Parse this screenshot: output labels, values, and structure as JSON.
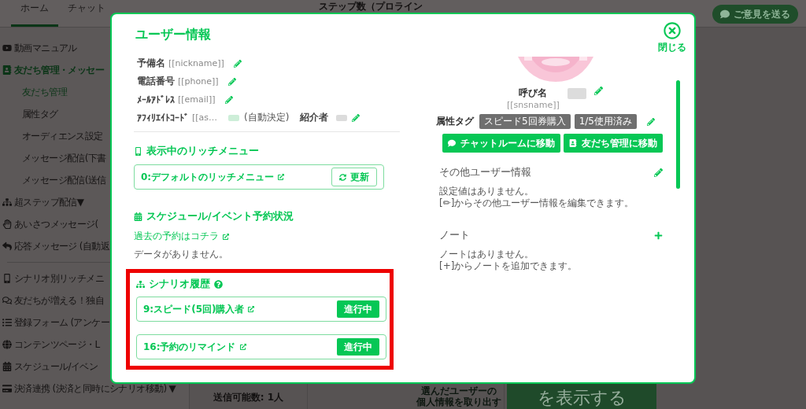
{
  "nav": {
    "tabs": [
      {
        "label": "ホーム",
        "selected": true
      },
      {
        "label": "チャット",
        "selected": false
      }
    ],
    "header_text": "ステップ数（プロライン",
    "feedback_button": "ご意見を送る"
  },
  "sidebar": {
    "groups": [
      {
        "items": [
          {
            "label": "動画マニュアル",
            "selected": false
          },
          {
            "label": "友だち管理・メッセー",
            "selected": true,
            "children": [
              {
                "label": "友だち管理",
                "selected": true
              },
              {
                "label": "属性タグ",
                "selected": false
              },
              {
                "label": "オーディエンス設定",
                "selected": false
              },
              {
                "label": "メッセージ配信(下書",
                "selected": false
              },
              {
                "label": "メッセージ配信(送信",
                "selected": false
              }
            ]
          },
          {
            "label": "超ステップ配信▼",
            "selected": false
          },
          {
            "label": "あいさつメッセージ(",
            "selected": false
          },
          {
            "label": "応答メッセージ",
            "note": "(自動返",
            "selected": false
          }
        ]
      },
      {
        "items": [
          {
            "label": "シナリオ別リッチメニ",
            "selected": false
          },
          {
            "label": "友だちが増える！独自",
            "selected": false
          },
          {
            "label": "登録フォーム",
            "note": "(アンケー",
            "selected": false
          },
          {
            "label": "コンテンツページ・L",
            "selected": false
          },
          {
            "label": "スケジュール/イベン",
            "selected": false
          },
          {
            "label": "決済連携",
            "note": "(決済と同時にシナリオ移動)",
            "suffix": "▼",
            "selected": false
          }
        ]
      }
    ]
  },
  "main": {
    "send_count": "送信可能数: 1人",
    "extract_lines": [
      "選んだユーザーの",
      "個人情報を取り出す"
    ],
    "show_button": "を表示する"
  },
  "modal": {
    "title": "ユーザー情報",
    "close_label": "閉じる",
    "fields": [
      {
        "kind": "editable",
        "label": "予備名",
        "var": "[[nickname]]"
      },
      {
        "kind": "editable",
        "label": "電話番号",
        "var": "[[phone]]"
      },
      {
        "kind": "editable",
        "label": "ﾒｰﾙｱﾄﾞﾚｽ",
        "var": "[[email]]"
      },
      {
        "kind": "affiliate",
        "label": "ｱﾌｨﾘｴｲﾄｺｰﾄﾞ",
        "var": "[[as…",
        "auto_note": "(自動決定)",
        "referrer_label": "紹介者"
      }
    ],
    "rich_menu": {
      "title": "表示中のリッチメニュー",
      "item": "0:デフォルトのリッチメニュー",
      "refresh_button": "更新"
    },
    "schedule": {
      "title": "スケジュール/イベント予約状況",
      "past_link": "過去の予約はコチラ",
      "empty": "データがありません。"
    },
    "scenario_history": {
      "title": "シナリオ履歴",
      "highlighted": true,
      "items": [
        {
          "label": "9:スピード(5回)購入者",
          "status": "進行中"
        },
        {
          "label": "16:予約のリマインド",
          "status": "進行中"
        }
      ]
    },
    "profile": {
      "name_label": "呼び名",
      "name_var": "[[snsname]]",
      "tags_label": "属性タグ",
      "tags": [
        "スピード5回券購入",
        "1/5使用済み"
      ],
      "buttons": [
        {
          "kind": "chat",
          "label": "チャットルームに移動"
        },
        {
          "kind": "friends",
          "label": "友だち管理に移動"
        }
      ]
    },
    "other_info": {
      "title": "その他ユーザー情報",
      "lines": [
        "設定値はありません。",
        "[✏]からその他ユーザー情報を編集できます。"
      ]
    },
    "notes": {
      "title": "ノート",
      "lines": [
        "ノートはありません。",
        "[+]からノートを追加できます。"
      ]
    }
  }
}
